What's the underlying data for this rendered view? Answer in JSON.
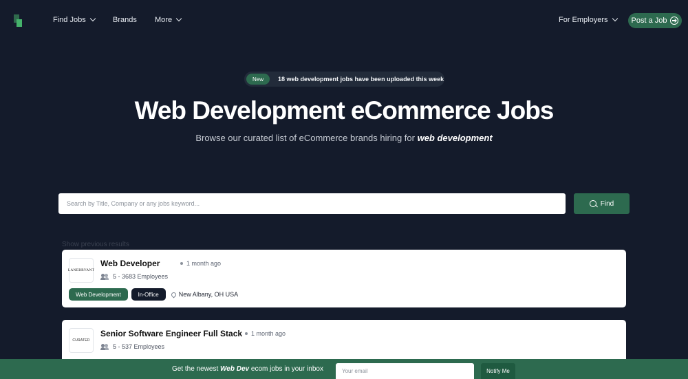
{
  "nav": {
    "find_jobs": "Find Jobs",
    "brands": "Brands",
    "more": "More",
    "for_employers": "For Employers",
    "post_job": "Post a Job"
  },
  "hero": {
    "badge": "New",
    "announcement": "18 web development jobs have been uploaded this week",
    "title": "Web Development eCommerce Jobs",
    "subtitle_prefix": "Browse our curated list of eCommerce brands hiring for ",
    "subtitle_emphasis": "web development"
  },
  "search": {
    "placeholder": "Search by Title, Company or any jobs keyword...",
    "button": "Find"
  },
  "results": {
    "show_previous": "Show previous results"
  },
  "jobs": [
    {
      "company_logo_text": "LANEBRYANT",
      "title": "Web Developer",
      "posted": "1 month ago",
      "employees": "5 - 3683 Employees",
      "tags": [
        "Web Development",
        "In-Office"
      ],
      "location": "New Albany, OH USA"
    },
    {
      "company_logo_text": "CURATED",
      "title": "Senior Software Engineer Full Stack",
      "posted": "1 month ago",
      "employees": "5 - 537 Employees"
    }
  ],
  "newsletter": {
    "prefix": "Get the newest ",
    "emphasis": "Web Dev",
    "suffix": " ecom jobs in your inbox",
    "placeholder": "Your email",
    "button": "Notify Me"
  },
  "colors": {
    "background": "#141b2b",
    "accent": "#2d6a4f",
    "card": "#ffffff"
  }
}
